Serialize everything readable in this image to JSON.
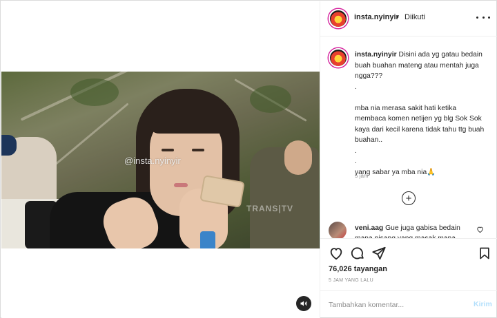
{
  "post": {
    "username": "insta.nyinyir",
    "dot": "•",
    "follow_status": "Diikuti",
    "caption_lines": [
      "Disini ada yg gatau bedain buah buahan mateng atau mentah juga ngga???",
      ".",
      "mba nia merasa sakit hati ketika membaca komen netijen yg blg Sok Sok kaya dari kecil karena tidak tahu ttg buah buahan..",
      ".",
      ".",
      "yang sabar ya mba nia🙏"
    ],
    "caption_time": "5 jam",
    "load_more_symbol": "+",
    "comment": {
      "username": "veni.aag",
      "text": "Gue juga gabisa bedain mana pisang yang masak mana"
    },
    "views": "76,026 tayangan",
    "posted_ago": "5 JAM YANG LALU",
    "add_comment_placeholder": "Tambahkan komentar...",
    "post_button": "Kirim"
  },
  "video": {
    "watermark": "@insta.nyinyir",
    "overlay_text": "TRANS|TV"
  },
  "colors": {
    "text": "#262626",
    "muted": "#8e8e8e",
    "border": "#efefef",
    "post_button_disabled": "#b2dffc"
  },
  "icons": [
    "more-icon",
    "heart-icon",
    "comment-icon",
    "share-icon",
    "bookmark-icon",
    "add-circle-icon",
    "sound-off-icon"
  ]
}
